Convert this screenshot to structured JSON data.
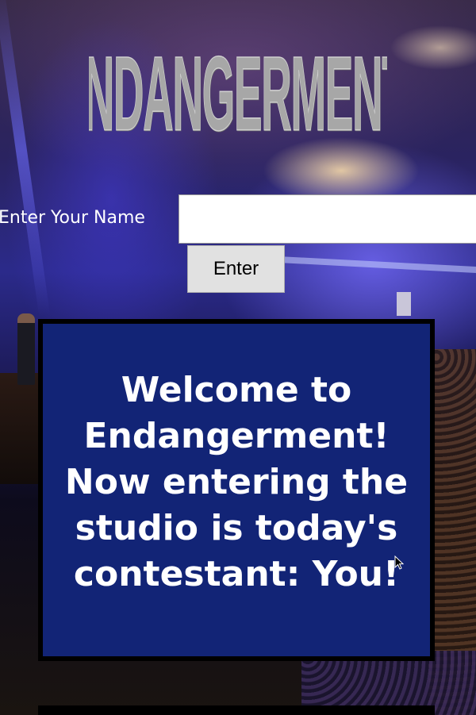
{
  "header": {
    "logo_text": "ENDANGERMENT!"
  },
  "name_form": {
    "label": "Enter Your Name",
    "input_value": "",
    "input_placeholder": "",
    "submit_label": "Enter"
  },
  "welcome": {
    "message": "Welcome to Endangerment! Now entering the studio is today's contestant: You!"
  },
  "colors": {
    "welcome_bg": "#122476",
    "logo_text": "#a7a7a7",
    "button_bg": "#e1e1e1"
  },
  "icons": {
    "cursor": "mouse-pointer-icon"
  }
}
